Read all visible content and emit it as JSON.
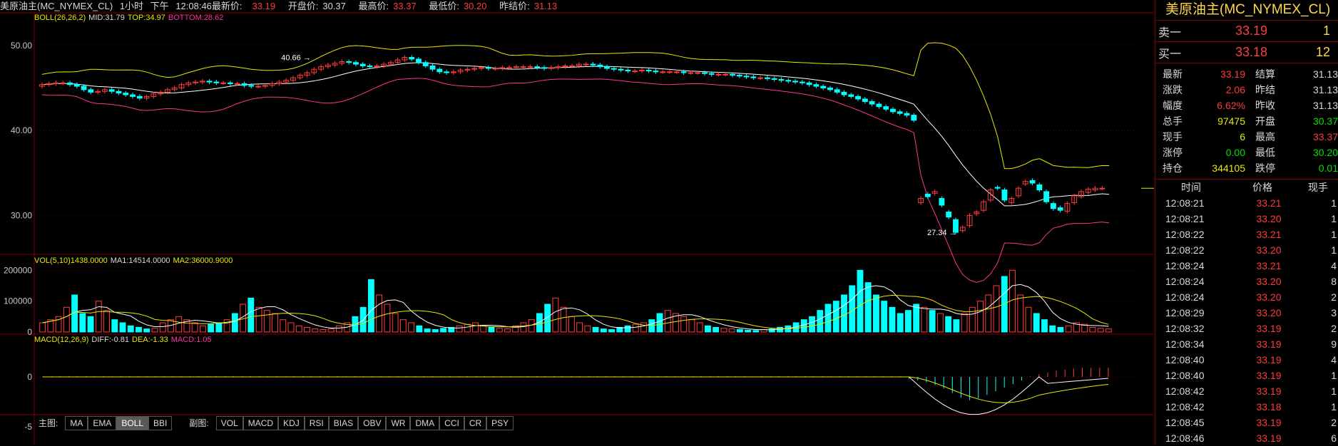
{
  "header": {
    "symbol": "美原油主(MC_NYMEX_CL)",
    "period": "1小时",
    "ampm": "下午",
    "time": "12:08:46",
    "last_label": "最新价:",
    "last": "33.19",
    "open_label": "开盘价:",
    "open": "30.37",
    "high_label": "最高价:",
    "high": "33.37",
    "low_label": "最低价:",
    "low": "30.20",
    "settle_label": "昨结价:",
    "settle": "31.13"
  },
  "colors": {
    "up": "#ff3b3b",
    "down": "#00ffff",
    "mid": "#ffffff",
    "top": "#e8e800",
    "bottom": "#ff3399",
    "grid": "#7a0000"
  },
  "boll": {
    "name": "BOLL(26,26,2)",
    "mid": "MID:31.79",
    "top": "TOP:34.97",
    "bottom": "BOTTOM:28.62"
  },
  "vol_ind": {
    "name": "VOL(5,10)1438.0000",
    "ma1": "MA1:14514.0000",
    "ma2": "MA2:36000.9000"
  },
  "macd_ind": {
    "name": "MACD(12,26,9)",
    "diff": "DIFF:-0.81",
    "dea": "DEA:-1.33",
    "macd": "MACD:1.05"
  },
  "annotations": {
    "high_mark": "40.66",
    "low_mark": "27.34"
  },
  "price_axis": [
    "50.00",
    "40.00",
    "30.00"
  ],
  "vol_axis": [
    "200000",
    "100000",
    "0"
  ],
  "macd_axis": [
    "0",
    "-5"
  ],
  "tabs": {
    "main_label": "主图:",
    "main": [
      "MA",
      "EMA",
      "BOLL",
      "BBI"
    ],
    "sub_label": "副图:",
    "sub": [
      "VOL",
      "MACD",
      "KDJ",
      "RSI",
      "BIAS",
      "OBV",
      "WR",
      "DMA",
      "CCI",
      "CR",
      "PSY"
    ],
    "active": "BOLL"
  },
  "quote": {
    "title": "美原油主(MC_NYMEX_CL)",
    "sell1": {
      "label": "卖一",
      "price": "33.19",
      "vol": "1"
    },
    "buy1": {
      "label": "买一",
      "price": "33.18",
      "vol": "12"
    },
    "stats": [
      {
        "k": "最新",
        "v": "33.19",
        "vc": "r",
        "k2": "结算",
        "v2": "31.13",
        "v2c": "w"
      },
      {
        "k": "涨跌",
        "v": "2.06",
        "vc": "r",
        "k2": "昨结",
        "v2": "31.13",
        "v2c": "w"
      },
      {
        "k": "幅度",
        "v": "6.62%",
        "vc": "r",
        "k2": "昨收",
        "v2": "31.13",
        "v2c": "w"
      },
      {
        "k": "总手",
        "v": "97475",
        "vc": "y",
        "k2": "开盘",
        "v2": "30.37",
        "v2c": "g"
      },
      {
        "k": "现手",
        "v": "6",
        "vc": "y",
        "k2": "最高",
        "v2": "33.37",
        "v2c": "r"
      },
      {
        "k": "涨停",
        "v": "0.00",
        "vc": "g",
        "k2": "最低",
        "v2": "30.20",
        "v2c": "g"
      },
      {
        "k": "持仓",
        "v": "344105",
        "vc": "y",
        "k2": "跌停",
        "v2": "0.01",
        "v2c": "g"
      }
    ],
    "ticks_header": {
      "time": "时间",
      "price": "价格",
      "vol": "现手"
    },
    "ticks": [
      {
        "t": "12:08:21",
        "p": "33.21",
        "v": "1"
      },
      {
        "t": "12:08:21",
        "p": "33.20",
        "v": "1"
      },
      {
        "t": "12:08:22",
        "p": "33.21",
        "v": "1"
      },
      {
        "t": "12:08:22",
        "p": "33.20",
        "v": "1"
      },
      {
        "t": "12:08:24",
        "p": "33.21",
        "v": "4"
      },
      {
        "t": "12:08:24",
        "p": "33.20",
        "v": "8"
      },
      {
        "t": "12:08:24",
        "p": "33.20",
        "v": "2"
      },
      {
        "t": "12:08:29",
        "p": "33.20",
        "v": "3"
      },
      {
        "t": "12:08:32",
        "p": "33.19",
        "v": "2"
      },
      {
        "t": "12:08:34",
        "p": "33.19",
        "v": "9"
      },
      {
        "t": "12:08:40",
        "p": "33.19",
        "v": "4"
      },
      {
        "t": "12:08:40",
        "p": "33.19",
        "v": "1"
      },
      {
        "t": "12:08:42",
        "p": "33.19",
        "v": "1"
      },
      {
        "t": "12:08:42",
        "p": "33.18",
        "v": "1"
      },
      {
        "t": "12:08:45",
        "p": "33.19",
        "v": "2"
      },
      {
        "t": "12:08:46",
        "p": "33.19",
        "v": "6"
      }
    ]
  },
  "chart_data": {
    "type": "candlestick",
    "ylim": [
      26,
      52
    ],
    "candles_open": [
      45.2,
      45.4,
      45.5,
      45.6,
      45.6,
      45.4,
      45.2,
      44.8,
      44.5,
      44.6,
      44.8,
      44.6,
      44.4,
      44.2,
      44.0,
      43.8,
      44.0,
      44.3,
      44.5,
      44.8,
      45.0,
      45.4,
      45.6,
      45.7,
      45.8,
      45.7,
      45.6,
      45.6,
      45.5,
      45.5,
      45.3,
      45.2,
      45.2,
      45.3,
      45.5,
      45.7,
      45.9,
      46.2,
      46.5,
      46.8,
      47.2,
      47.5,
      47.7,
      47.9,
      48.1,
      48.0,
      47.8,
      47.6,
      47.5,
      47.6,
      47.8,
      48.0,
      48.3,
      48.6,
      48.4,
      48.0,
      47.6,
      47.2,
      46.9,
      46.8,
      46.9,
      47.1,
      47.2,
      47.3,
      47.4,
      47.3,
      47.3,
      47.4,
      47.4,
      47.5,
      47.5,
      47.5,
      47.4,
      47.3,
      47.4,
      47.5,
      47.6,
      47.6,
      47.8,
      47.8,
      47.7,
      47.5,
      47.3,
      47.2,
      47.1,
      47.0,
      47.0,
      47.1,
      47.0,
      46.9,
      46.9,
      46.9,
      46.9,
      46.8,
      46.8,
      46.8,
      46.7,
      46.6,
      46.6,
      46.6,
      46.5,
      46.4,
      46.3,
      46.2,
      46.2,
      46.1,
      46.0,
      45.9,
      45.8,
      45.7,
      45.6,
      45.4,
      45.2,
      45.0,
      44.8,
      44.5,
      44.2,
      44.0,
      43.7,
      43.4,
      43.1,
      42.8,
      42.5,
      42.2,
      42.0,
      41.8,
      31.5,
      32.5,
      32.6,
      32.0,
      30.4,
      29.5,
      28.2,
      28.8,
      30.2,
      30.6,
      31.8,
      33.3,
      33.0,
      31.5,
      32.3,
      33.7,
      34.1,
      33.6,
      32.8,
      31.4,
      30.9,
      30.5,
      31.5,
      32.2,
      32.7,
      33.0,
      33.2,
      33.3
    ],
    "candles_close": [
      45.4,
      45.5,
      45.6,
      45.6,
      45.4,
      45.2,
      44.8,
      44.5,
      44.6,
      44.8,
      44.6,
      44.4,
      44.2,
      44.0,
      43.8,
      44.0,
      44.3,
      44.5,
      44.8,
      45.0,
      45.4,
      45.6,
      45.7,
      45.8,
      45.7,
      45.6,
      45.6,
      45.5,
      45.5,
      45.3,
      45.2,
      45.2,
      45.3,
      45.5,
      45.7,
      45.9,
      46.2,
      46.5,
      46.8,
      47.2,
      47.5,
      47.7,
      47.9,
      48.1,
      48.0,
      47.8,
      47.6,
      47.5,
      47.6,
      47.8,
      48.0,
      48.3,
      48.6,
      48.4,
      48.0,
      47.6,
      47.2,
      46.9,
      46.8,
      46.9,
      47.1,
      47.2,
      47.3,
      47.4,
      47.3,
      47.3,
      47.4,
      47.4,
      47.5,
      47.5,
      47.5,
      47.4,
      47.3,
      47.4,
      47.5,
      47.6,
      47.6,
      47.8,
      47.8,
      47.7,
      47.5,
      47.3,
      47.2,
      47.1,
      47.0,
      47.0,
      47.1,
      47.0,
      46.9,
      46.9,
      46.9,
      46.9,
      46.8,
      46.8,
      46.8,
      46.7,
      46.6,
      46.6,
      46.6,
      46.5,
      46.4,
      46.3,
      46.2,
      46.2,
      46.1,
      46.0,
      45.9,
      45.8,
      45.7,
      45.6,
      45.4,
      45.2,
      45.0,
      44.8,
      44.5,
      44.2,
      44.0,
      43.7,
      43.4,
      43.1,
      42.8,
      42.5,
      42.2,
      42.0,
      41.8,
      41.2,
      32.0,
      32.2,
      32.8,
      31.2,
      29.8,
      28.0,
      28.6,
      30.0,
      30.4,
      31.6,
      33.0,
      33.2,
      31.8,
      32.0,
      33.2,
      34.0,
      33.8,
      33.0,
      31.6,
      30.8,
      30.6,
      31.4,
      32.3,
      32.8,
      33.1,
      33.2,
      33.2
    ],
    "vol_ma_note": "",
    "volumes": [
      30000,
      40000,
      50000,
      80000,
      120000,
      60000,
      50000,
      100000,
      70000,
      40000,
      30000,
      20000,
      15000,
      10000,
      12000,
      30000,
      40000,
      50000,
      40000,
      30000,
      20000,
      25000,
      30000,
      40000,
      60000,
      90000,
      110000,
      80000,
      70000,
      60000,
      40000,
      30000,
      20000,
      15000,
      10000,
      8000,
      10000,
      20000,
      30000,
      50000,
      80000,
      170000,
      120000,
      90000,
      60000,
      40000,
      30000,
      20000,
      10000,
      8000,
      12000,
      15000,
      20000,
      25000,
      30000,
      20000,
      15000,
      12000,
      10000,
      20000,
      30000,
      40000,
      60000,
      90000,
      110000,
      80000,
      50000,
      30000,
      20000,
      15000,
      10000,
      8000,
      15000,
      20000,
      25000,
      30000,
      40000,
      60000,
      70000,
      60000,
      50000,
      40000,
      30000,
      20000,
      15000,
      12000,
      10000,
      8000,
      6000,
      5000,
      8000,
      10000,
      15000,
      20000,
      30000,
      40000,
      50000,
      70000,
      90000,
      100000,
      120000,
      150000,
      200000,
      160000,
      120000,
      100000,
      80000,
      60000,
      70000,
      90000,
      80000,
      70000,
      60000,
      50000,
      40000,
      60000,
      80000,
      100000,
      120000,
      150000,
      180000,
      200000,
      120000,
      80000,
      60000,
      40000,
      20000,
      15000,
      20000,
      30000,
      25000,
      15000,
      12000,
      10000
    ],
    "macd": [
      0.1,
      0.1,
      0.1,
      0.1,
      0.1,
      0.1,
      0.1,
      0.1,
      0.1,
      0.1,
      0.1,
      0.1,
      0.1,
      0.1,
      0.1,
      0.1,
      0.1,
      0.1,
      0.1,
      0.1,
      0.1,
      0.1,
      0.1,
      0.1,
      0.1,
      0.1,
      0.1,
      0.1,
      0.1,
      0.1,
      0.1,
      0.1,
      0.1,
      0.1,
      0.1,
      0.1,
      0.1,
      0.1,
      0.1,
      0.1,
      0.1,
      0.1,
      0.1,
      0.1,
      0.1,
      0.1,
      0.1,
      0.1,
      0.1,
      0.1,
      0.1,
      0.1,
      0.1,
      0.1,
      0.1,
      0.1,
      0.1,
      0.1,
      0.1,
      0.1,
      0.1,
      0.1,
      0.1,
      0.1,
      0.1,
      0.1,
      0.1,
      0.1,
      0.1,
      0.1,
      0.1,
      0.1,
      0.1,
      0.1,
      0.1,
      0.1,
      0.1,
      0.1,
      0.1,
      0.1,
      0.1,
      0.1,
      0.1,
      0.1,
      0.1,
      0.1,
      0.1,
      0.1,
      0.1,
      0.1,
      0.1,
      0.1,
      0.1,
      0.1,
      0.1,
      0.1,
      0.1,
      0.1,
      0.1,
      0.1,
      -0.2,
      -0.4,
      -0.6,
      -0.9,
      -1.3,
      -1.8,
      -2.3,
      -2.6,
      -2.4,
      -2.0,
      -1.6,
      -1.2,
      -0.8,
      -0.4,
      0.1,
      0.3,
      0.5,
      0.7,
      0.8,
      0.9,
      1.0,
      1.0,
      1.0,
      1.05
    ]
  }
}
